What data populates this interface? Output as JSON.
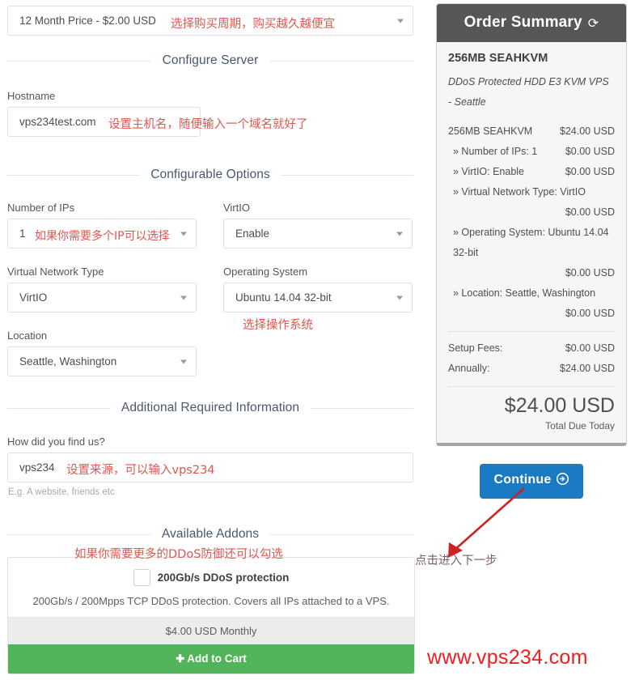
{
  "billing_cycle": {
    "label": "12 Month Price - $2.00 USD",
    "annotation": "选择购买周期，购买越久越便宜"
  },
  "sections": {
    "configure_server": "Configure Server",
    "configurable_options": "Configurable Options",
    "additional_info": "Additional Required Information",
    "available_addons": "Available Addons"
  },
  "hostname": {
    "label": "Hostname",
    "value": "vps234test.com",
    "annotation": "设置主机名，随便输入一个域名就好了"
  },
  "options": {
    "number_of_ips": {
      "label": "Number of IPs",
      "value": "1",
      "annotation": "如果你需要多个IP可以选择"
    },
    "virtio": {
      "label": "VirtIO",
      "value": "Enable"
    },
    "virtual_network_type": {
      "label": "Virtual Network Type",
      "value": "VirtIO"
    },
    "operating_system": {
      "label": "Operating System",
      "value": "Ubuntu 14.04 32-bit",
      "annotation": "选择操作系统"
    },
    "location": {
      "label": "Location",
      "value": "Seattle, Washington"
    }
  },
  "find_us": {
    "label": "How did you find us?",
    "value": "vps234",
    "help": "E.g. A website, friends etc",
    "annotation": "设置来源，可以输入vps234"
  },
  "addon": {
    "annotation": "如果你需要更多的DDoS防御还可以勾选",
    "title": "200Gb/s DDoS protection",
    "description": "200Gb/s / 200Mpps TCP DDoS protection. Covers all IPs attached to a VPS.",
    "price": "$4.00 USD Monthly",
    "cart_button": "Add to Cart",
    "plus_icon": "✚"
  },
  "order_summary": {
    "title": "Order Summary",
    "refresh_icon": "⟳",
    "product_name": "256MB SEAHKVM",
    "product_description": "DDoS Protected HDD E3 KVM VPS - Seattle",
    "line_items": [
      {
        "label": "256MB SEAHKVM",
        "amount": "$24.00 USD",
        "sub": false
      },
      {
        "label": "» Number of IPs: 1",
        "amount": "$0.00 USD",
        "sub": true
      },
      {
        "label": "» VirtIO: Enable",
        "amount": "$0.00 USD",
        "sub": true
      },
      {
        "label": "» Virtual Network Type: VirtIO",
        "amount": "$0.00 USD",
        "sub": true
      },
      {
        "label": "» Operating System: Ubuntu 14.04 32-bit",
        "amount": "$0.00 USD",
        "sub": true
      },
      {
        "label": "» Location: Seattle, Washington",
        "amount": "$0.00 USD",
        "sub": true
      }
    ],
    "fees": [
      {
        "label": "Setup Fees:",
        "amount": "$0.00 USD"
      },
      {
        "label": "Annually:",
        "amount": "$24.00 USD"
      }
    ],
    "total_amount": "$24.00 USD",
    "total_label": "Total Due Today"
  },
  "continue": {
    "label": "Continue",
    "arrow_icon": "➜",
    "annotation": "点击进入下一步"
  },
  "watermark": "www.vps234.com",
  "colors": {
    "panel_header": "#565656",
    "continue_blue": "#1a7bc4",
    "cart_green": "#51b45a",
    "annotation_red": "#e2372f",
    "watermark_red": "#f31c1c",
    "section_heading": "#49586b"
  }
}
